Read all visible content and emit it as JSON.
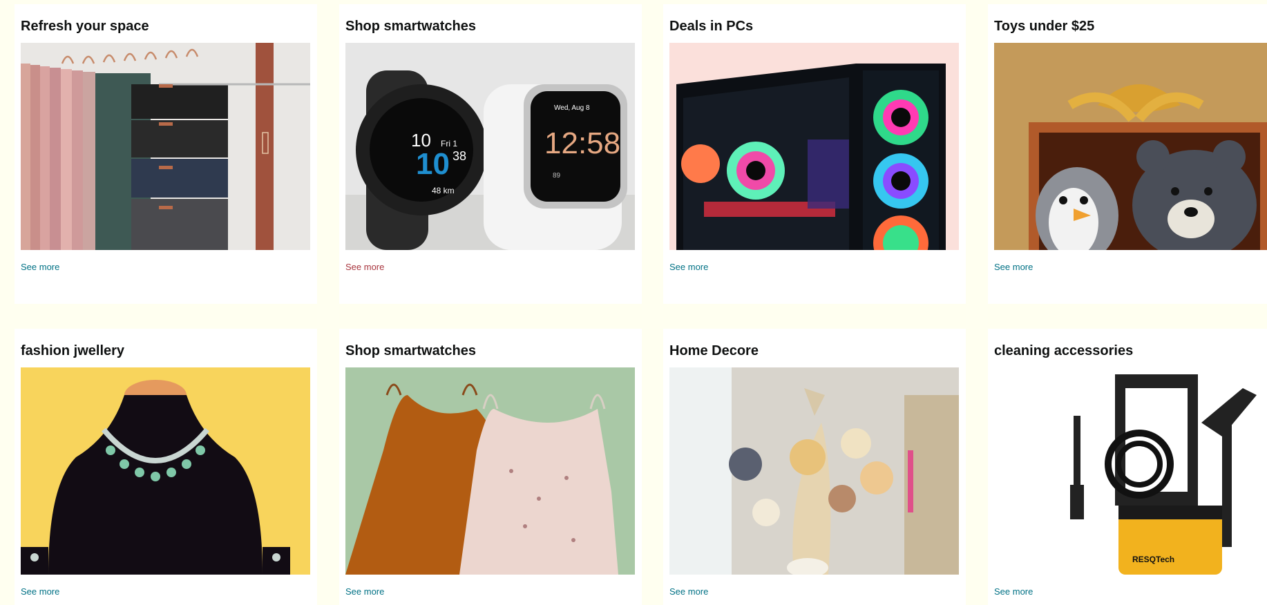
{
  "cards": [
    {
      "title": "Refresh your space",
      "link": "See more",
      "image": "clothes-hanger-image"
    },
    {
      "title": "Shop smartwatches",
      "link": "See more",
      "image": "smartwatches-image",
      "watch_text": [
        "10",
        "Fri 1",
        "10",
        "38",
        "48 km",
        "Wed, Aug 8",
        "12:58",
        "89"
      ]
    },
    {
      "title": "Deals in PCs",
      "link": "See more",
      "image": "gaming-pc-image"
    },
    {
      "title": "Toys under $25",
      "link": "See more",
      "image": "plush-toys-image"
    },
    {
      "title": "fashion jwellery",
      "link": "See more",
      "image": "necklace-image"
    },
    {
      "title": "Shop smartwatches",
      "link": "See more",
      "image": "dresses-image"
    },
    {
      "title": "Home Decore",
      "link": "See more",
      "image": "dried-flowers-image"
    },
    {
      "title": "cleaning accessories",
      "link": "See more",
      "image": "pressure-washer-image",
      "brand_text": "RESQTech"
    }
  ],
  "colors": {
    "page_bg": "#fffff0",
    "card_bg": "#ffffff",
    "link": "#007185",
    "link_visited": "#a8343d"
  }
}
